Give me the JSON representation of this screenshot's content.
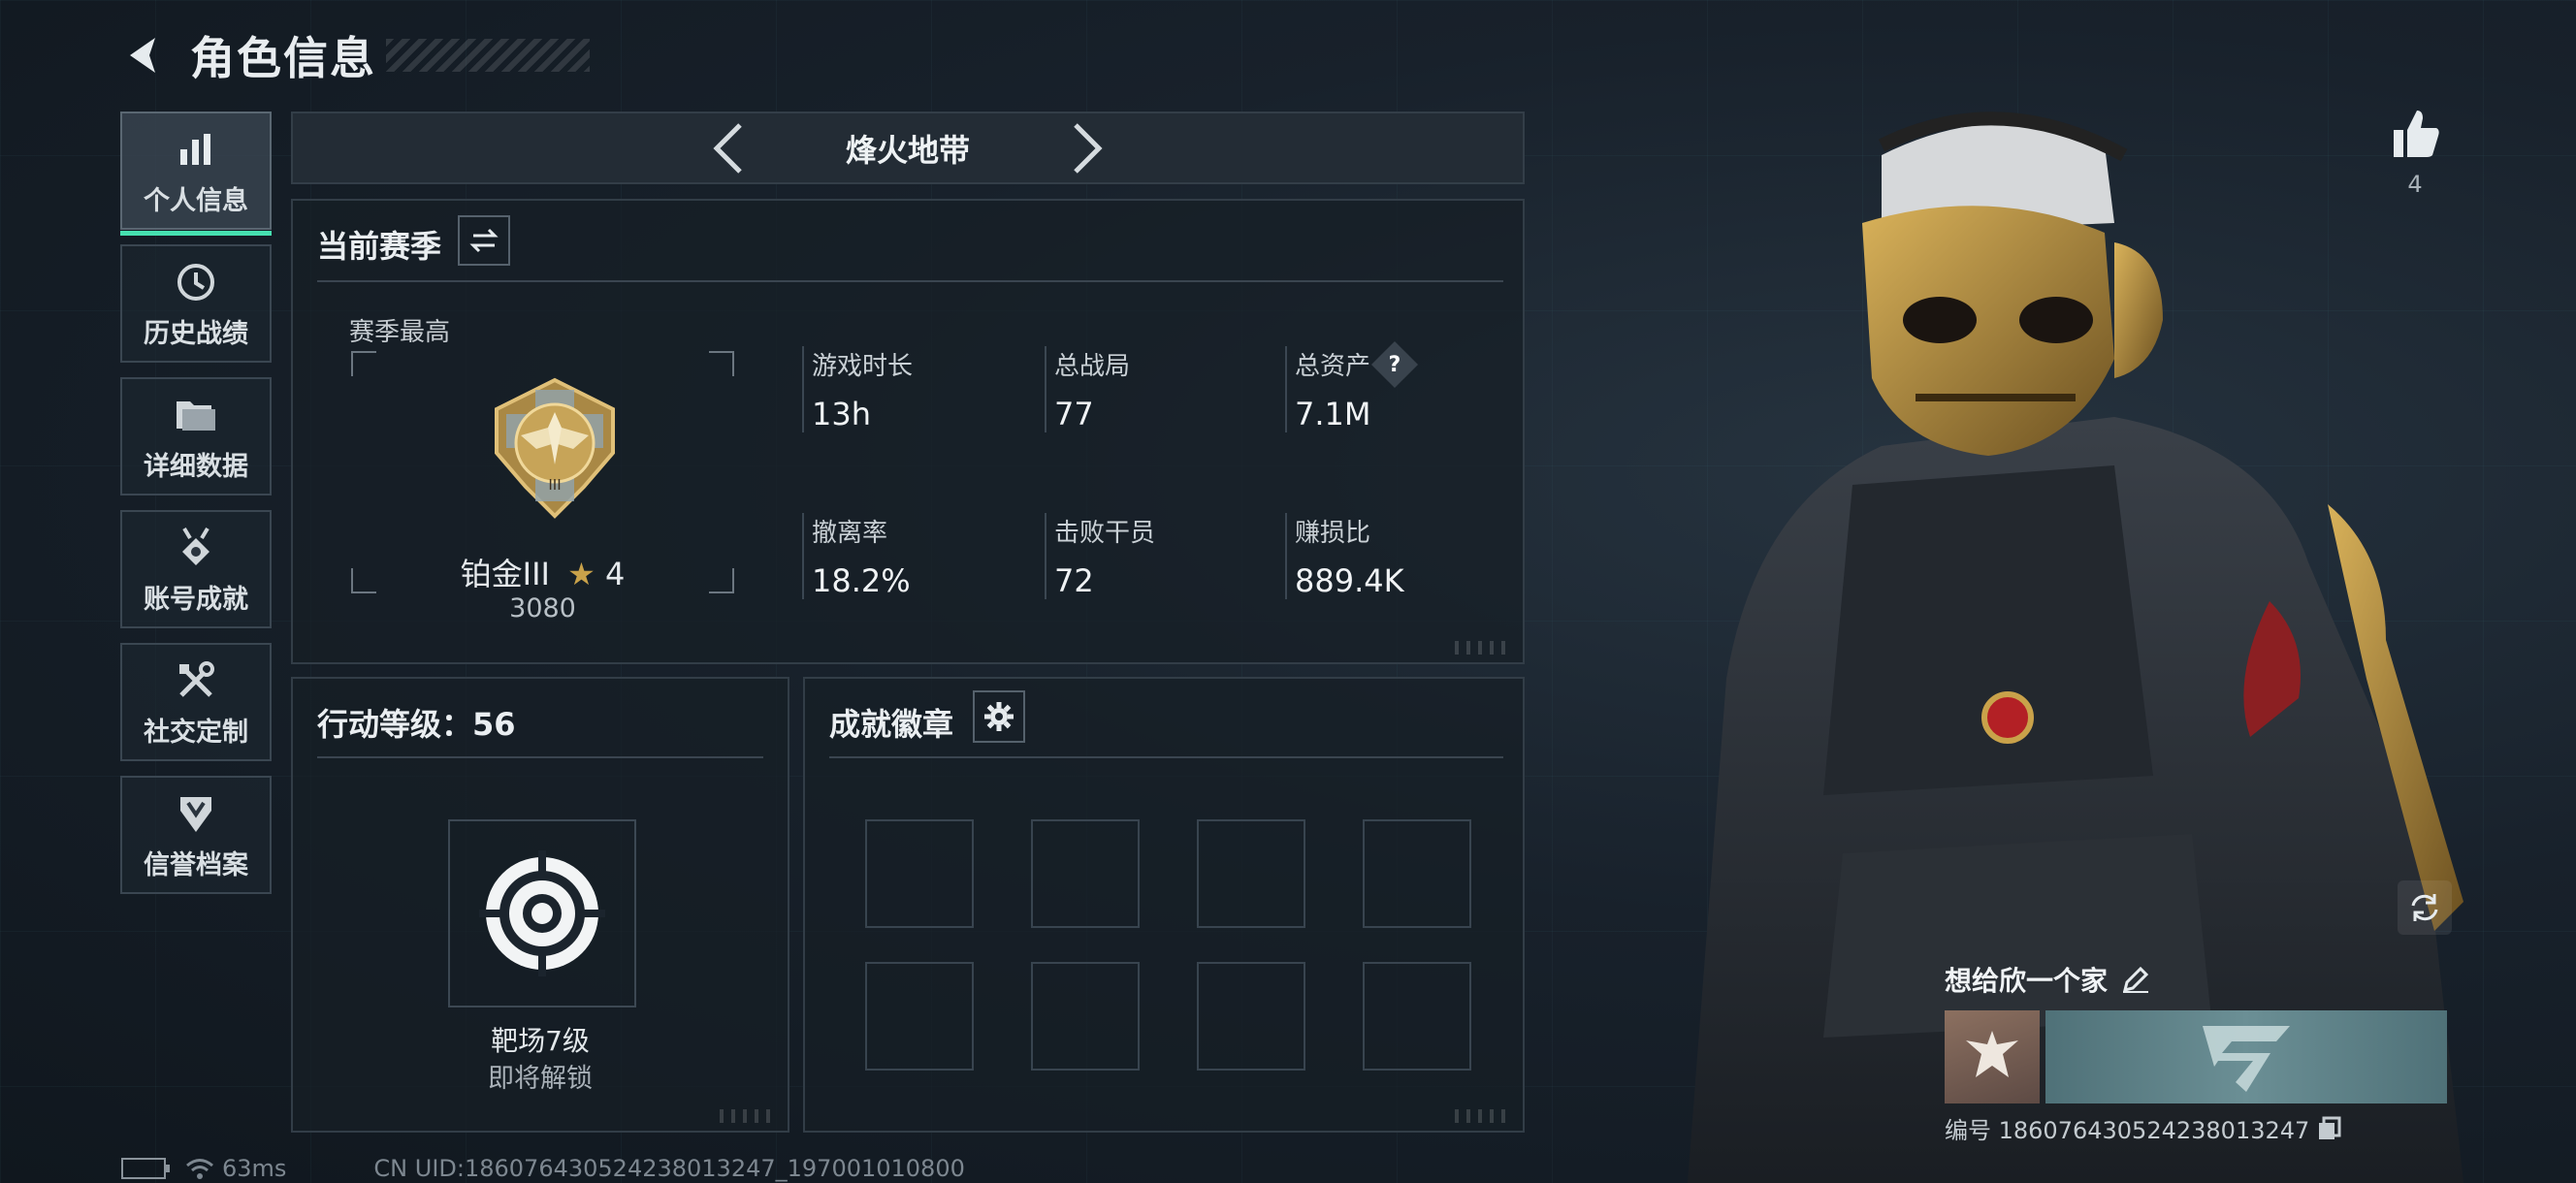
{
  "header": {
    "title": "角色信息"
  },
  "sidebar": {
    "items": [
      {
        "label": "个人信息",
        "icon": "bar-chart-icon",
        "active": true
      },
      {
        "label": "历史战绩",
        "icon": "clock-icon"
      },
      {
        "label": "详细数据",
        "icon": "folder-icon"
      },
      {
        "label": "账号成就",
        "icon": "medal-icon"
      },
      {
        "label": "社交定制",
        "icon": "tools-icon"
      },
      {
        "label": "信誉档案",
        "icon": "shield-icon"
      }
    ]
  },
  "mode": {
    "name": "烽火地带"
  },
  "season": {
    "title": "当前赛季",
    "best_label": "赛季最高",
    "rank_name": "铂金III",
    "rank_stars": "4",
    "rank_score": "3080",
    "stats": [
      {
        "label": "游戏时长",
        "value": "13h"
      },
      {
        "label": "总战局",
        "value": "77"
      },
      {
        "label": "总资产",
        "value": "7.1M",
        "help": "?"
      },
      {
        "label": "撤离率",
        "value": "18.2%"
      },
      {
        "label": "击败干员",
        "value": "72"
      },
      {
        "label": "赚损比",
        "value": "889.4K"
      }
    ]
  },
  "level": {
    "title": "行动等级：56",
    "range_name": "靶场7级",
    "range_status": "即将解锁"
  },
  "badges": {
    "title": "成就徽章"
  },
  "footer": {
    "ping": "63ms",
    "uid": "CN UID:186076430524238013247_197001010800"
  },
  "profile": {
    "likes": "4",
    "nickname": "想给欣一个家",
    "id_line": "编号 186076430524238013247"
  },
  "colors": {
    "accent": "#46e0b0",
    "gold": "#c9a24a"
  }
}
